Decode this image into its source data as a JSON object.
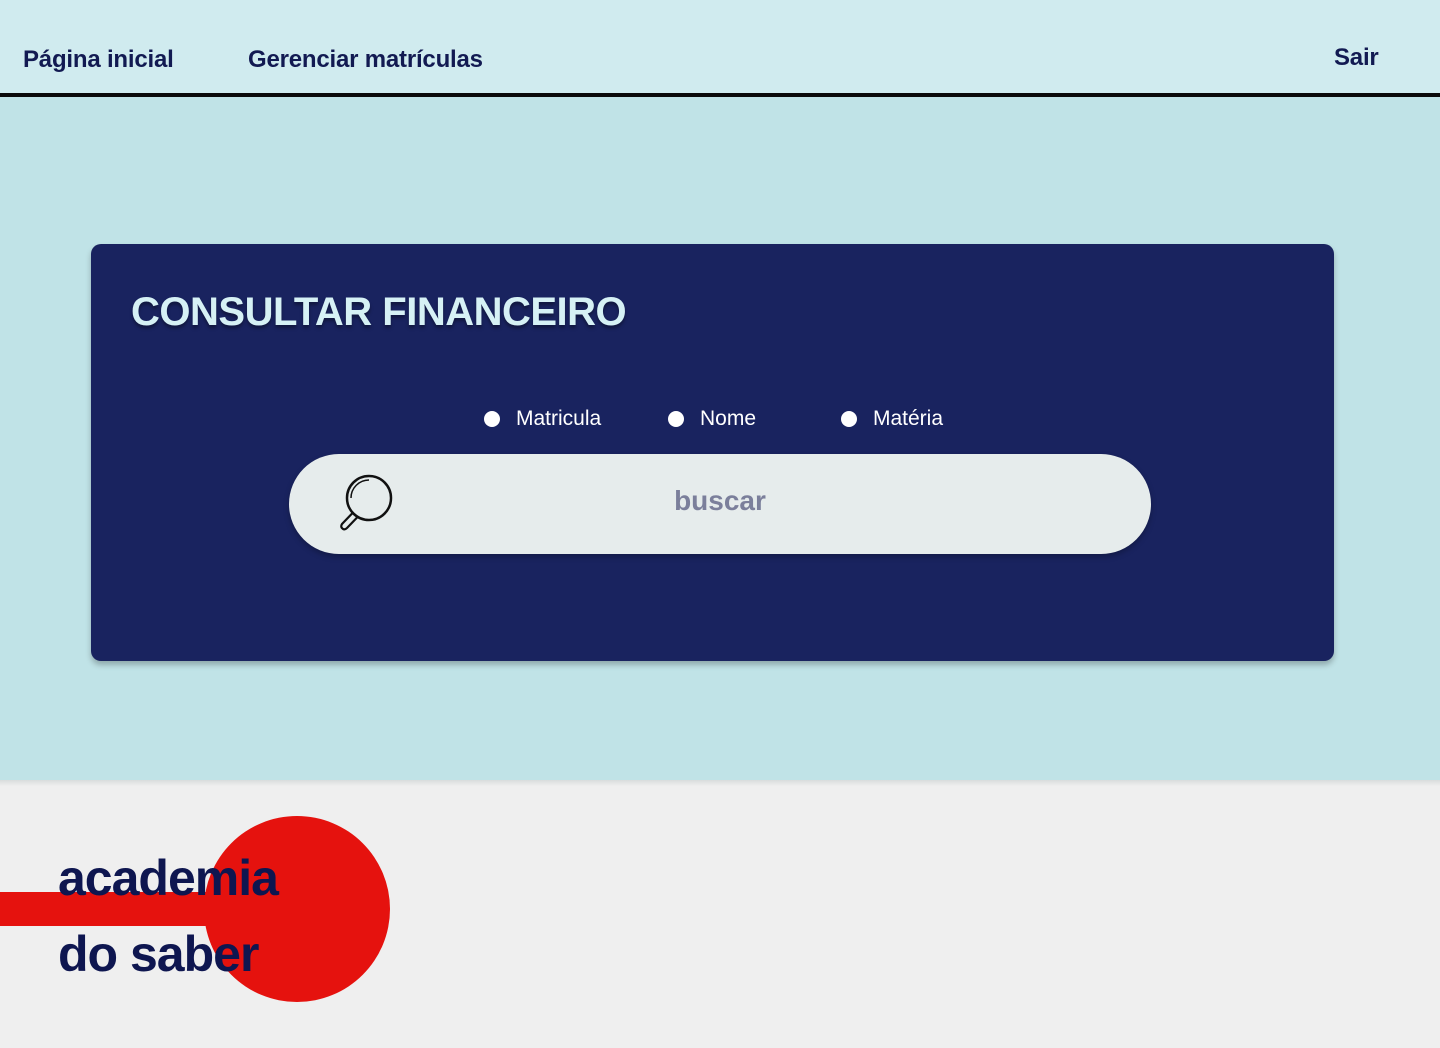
{
  "nav": {
    "home_label": "Página inicial",
    "manage_label": "Gerenciar matrículas",
    "logout_label": "Sair"
  },
  "search_card": {
    "title": "CONSULTAR FINANCEIRO",
    "filters": [
      "Matricula",
      "Nome",
      "Matéria"
    ],
    "search_placeholder": "buscar",
    "search_icon": "search-icon"
  },
  "logo": {
    "line1": "academia",
    "line2": "do saber"
  },
  "colors": {
    "page_bg": "#c0e3e7",
    "nav_bg": "#d0ebef",
    "card_bg": "#19235f",
    "text_dark": "#121a52",
    "logo_red": "#e5120e",
    "footer_bg": "#efefef"
  }
}
